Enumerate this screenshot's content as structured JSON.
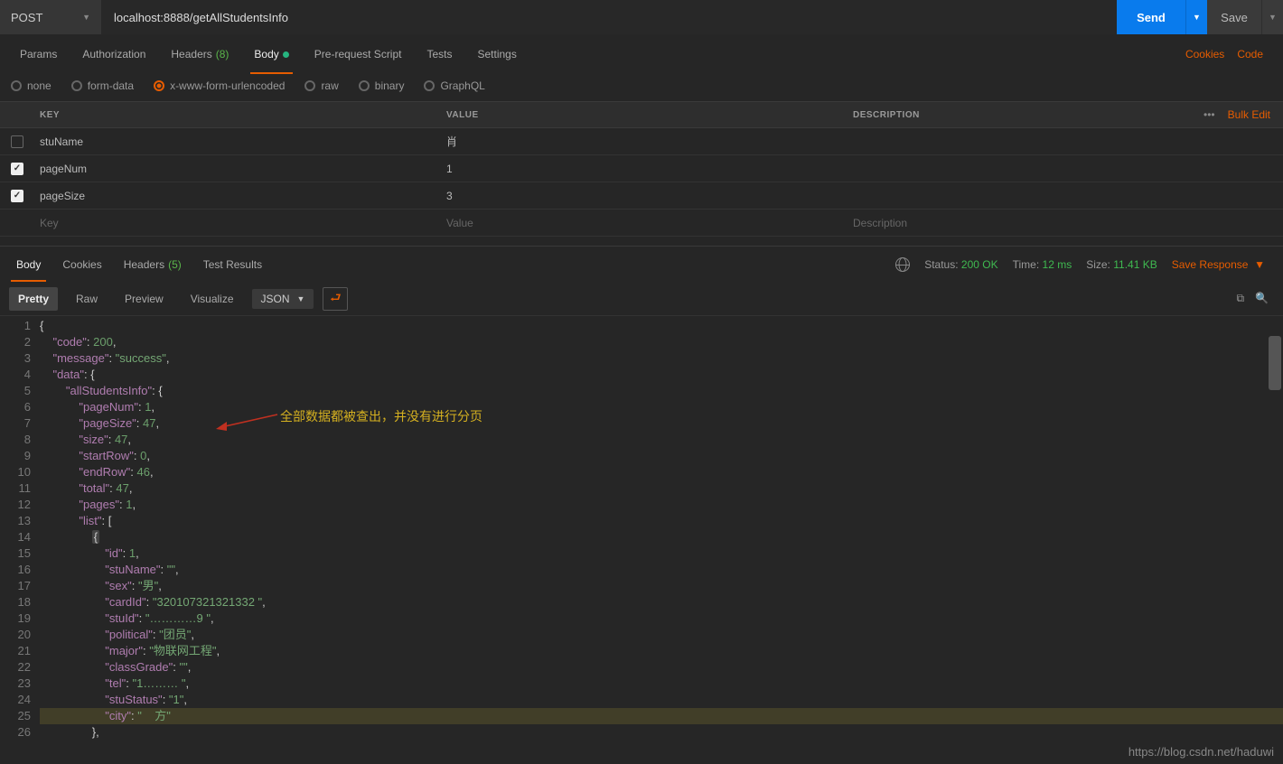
{
  "request": {
    "method": "POST",
    "url": "localhost:8888/getAllStudentsInfo",
    "send": "Send",
    "save": "Save"
  },
  "tabs": {
    "params": "Params",
    "auth": "Authorization",
    "headers": "Headers",
    "headers_count": "(8)",
    "body": "Body",
    "prereq": "Pre-request Script",
    "tests": "Tests",
    "settings": "Settings",
    "cookies": "Cookies",
    "code": "Code"
  },
  "bodyTypes": {
    "none": "none",
    "form": "form-data",
    "xwww": "x-www-form-urlencoded",
    "raw": "raw",
    "binary": "binary",
    "gql": "GraphQL"
  },
  "tableHead": {
    "key": "KEY",
    "value": "VALUE",
    "desc": "DESCRIPTION",
    "bulk": "Bulk Edit",
    "dots": "•••"
  },
  "rows": [
    {
      "checked": false,
      "key": "stuName",
      "value": "肖"
    },
    {
      "checked": true,
      "key": "pageNum",
      "value": "1"
    },
    {
      "checked": true,
      "key": "pageSize",
      "value": "3"
    }
  ],
  "placeholders": {
    "key": "Key",
    "value": "Value",
    "desc": "Description"
  },
  "respTabs": {
    "body": "Body",
    "cookies": "Cookies",
    "headers": "Headers",
    "headers_count": "(5)",
    "tests": "Test Results"
  },
  "respMeta": {
    "statusL": "Status:",
    "status": "200 OK",
    "timeL": "Time:",
    "time": "12 ms",
    "sizeL": "Size:",
    "size": "11.41 KB",
    "save": "Save Response"
  },
  "viewRow": {
    "pretty": "Pretty",
    "raw": "Raw",
    "preview": "Preview",
    "visualize": "Visualize",
    "json": "JSON"
  },
  "annotation": "全部数据都被查出，并没有进行分页",
  "json": {
    "code": 200,
    "message": "success",
    "data": {
      "allStudentsInfo": {
        "pageNum": 1,
        "pageSize": 47,
        "size": 47,
        "startRow": 0,
        "endRow": 46,
        "total": 47,
        "pages": 1,
        "list": [
          {
            "id": 1,
            "stuName": "",
            "sex": "男",
            "cardId": "320107321321332 ",
            "stuId": "…………9 ",
            "political": "团员",
            "major": "物联网工程",
            "classGrade": "",
            "tel": "1……… ",
            "stuStatus": "1",
            "city": "    方"
          }
        ]
      }
    }
  },
  "watermark": "https://blog.csdn.net/haduwi"
}
